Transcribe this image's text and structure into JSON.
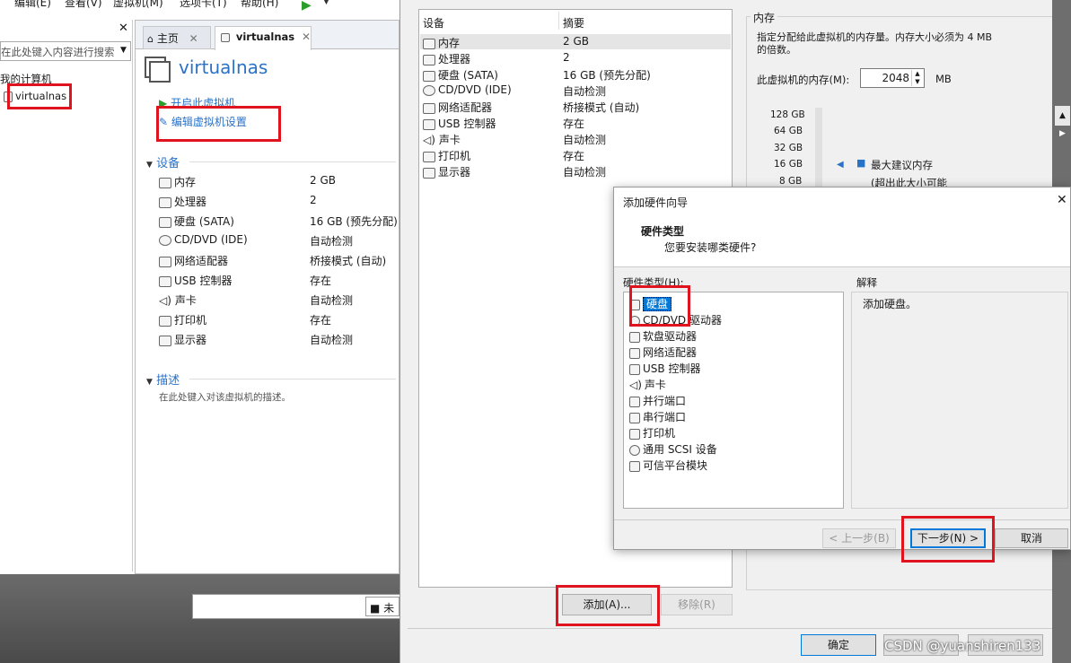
{
  "menubar": {
    "items": [
      "编辑(E)",
      "查看(V)",
      "虚拟机(M)",
      "选项卡(T)",
      "帮助(H)"
    ]
  },
  "library": {
    "search_placeholder": "在此处键入内容进行搜索",
    "root": "我的计算机",
    "vm": "virtualnas"
  },
  "tabs": {
    "home": "主页",
    "vm": "virtualnas"
  },
  "vm": {
    "title": "virtualnas",
    "start": "开启此虚拟机",
    "edit": "编辑虚拟机设置",
    "devices_header": "设备",
    "devices": [
      {
        "name": "内存",
        "value": "2 GB"
      },
      {
        "name": "处理器",
        "value": "2"
      },
      {
        "name": "硬盘 (SATA)",
        "value": "16 GB (预先分配)"
      },
      {
        "name": "CD/DVD (IDE)",
        "value": "自动检测"
      },
      {
        "name": "网络适配器",
        "value": "桥接模式 (自动)"
      },
      {
        "name": "USB 控制器",
        "value": "存在"
      },
      {
        "name": "声卡",
        "value": "自动检测"
      },
      {
        "name": "打印机",
        "value": "存在"
      },
      {
        "name": "显示器",
        "value": "自动检测"
      }
    ],
    "desc_header": "描述",
    "desc_placeholder": "在此处键入对该虚拟机的描述。"
  },
  "settings": {
    "col_device": "设备",
    "col_summary": "摘要",
    "devices": [
      {
        "name": "内存",
        "value": "2 GB"
      },
      {
        "name": "处理器",
        "value": "2"
      },
      {
        "name": "硬盘 (SATA)",
        "value": "16 GB (预先分配)"
      },
      {
        "name": "CD/DVD (IDE)",
        "value": "自动检测"
      },
      {
        "name": "网络适配器",
        "value": "桥接模式 (自动)"
      },
      {
        "name": "USB 控制器",
        "value": "存在"
      },
      {
        "name": "声卡",
        "value": "自动检测"
      },
      {
        "name": "打印机",
        "value": "存在"
      },
      {
        "name": "显示器",
        "value": "自动检测"
      }
    ],
    "memory_group": "内存",
    "memory_desc1": "指定分配给此虚拟机的内存量。内存大小必须为 4 MB",
    "memory_desc2": "的倍数。",
    "memory_label": "此虚拟机的内存(M):",
    "memory_value": "2048",
    "memory_unit": "MB",
    "scale": [
      "128 GB",
      "64 GB",
      "32 GB",
      "16 GB",
      "8 GB"
    ],
    "legend_max": "最大建议内存",
    "legend_sub": "(超出此大小可能",
    "add_btn": "添加(A)...",
    "remove_btn": "移除(R)",
    "ok_btn": "确定"
  },
  "bottom": {
    "status": "未"
  },
  "wizard": {
    "title": "添加硬件向导",
    "heading": "硬件类型",
    "subheading": "您要安装哪类硬件?",
    "list_label": "硬件类型(H):",
    "explain_label": "解释",
    "explain_text": "添加硬盘。",
    "items": [
      "硬盘",
      "CD/DVD 驱动器",
      "软盘驱动器",
      "网络适配器",
      "USB 控制器",
      "声卡",
      "并行端口",
      "串行端口",
      "打印机",
      "通用 SCSI 设备",
      "可信平台模块"
    ],
    "back_btn": "< 上一步(B)",
    "next_btn": "下一步(N) >",
    "cancel_btn": "取消"
  },
  "watermark": "CSDN @yuanshiren133",
  "colors": {
    "highlight": "#e0141e",
    "selection": "#0078d7",
    "title_blue": "#2a72c8"
  }
}
